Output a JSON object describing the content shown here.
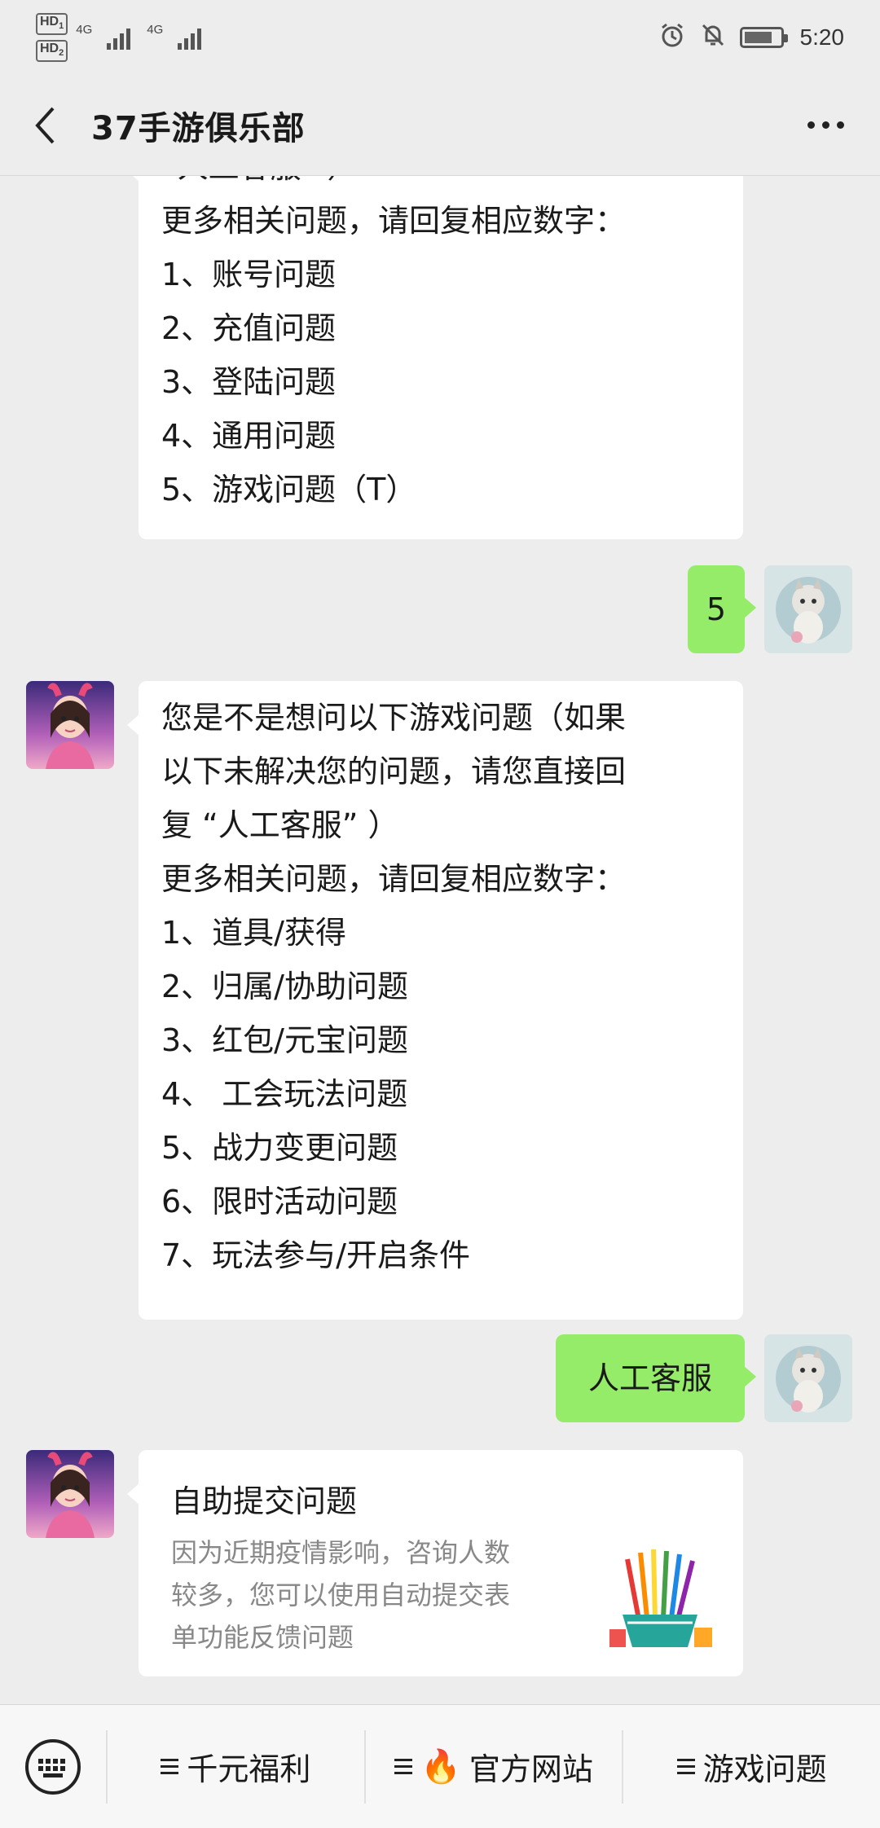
{
  "status_bar": {
    "hd1": "HD",
    "hd1_sub": "1",
    "hd2": "HD",
    "hd2_sub": "2",
    "net1": "4G",
    "net2": "4G",
    "time": "5:20",
    "icons": [
      "alarm-icon",
      "mute-icon",
      "battery-icon"
    ]
  },
  "header": {
    "title": "37手游俱乐部",
    "back_icon": "chevron-left-icon",
    "more_icon": "more-dots-icon"
  },
  "messages": [
    {
      "side": "in",
      "lines": [
        "“人工客服” ）",
        "更多相关问题，请回复相应数字：",
        "1、账号问题",
        "2、充值问题",
        "3、登陆问题",
        "4、通用问题",
        "5、游戏问题（T）"
      ]
    },
    {
      "side": "out",
      "text": "5"
    },
    {
      "side": "in",
      "lines": [
        "您是不是想问以下游戏问题（如果",
        "以下未解决您的问题，请您直接回",
        "复 “人工客服” ）",
        "更多相关问题，请回复相应数字：",
        "1、道具/获得",
        "2、归属/协助问题",
        "3、红包/元宝问题",
        "4、 工会玩法问题",
        "5、战力变更问题",
        "6、限时活动问题",
        "7、玩法参与/开启条件"
      ]
    },
    {
      "side": "out",
      "text": "人工客服"
    },
    {
      "side": "in",
      "card": {
        "title": "自助提交问题",
        "desc_lines": [
          "因为近期疫情影响，咨询人数",
          "较多，您可以使用自动提交表",
          "单功能反馈问题"
        ]
      }
    }
  ],
  "bottom_menu": {
    "keyboard_icon": "keyboard-icon",
    "items": [
      {
        "label": "千元福利",
        "icon": "menu-lines-icon"
      },
      {
        "label": "官方网站",
        "icon": "menu-lines-icon",
        "emoji": "🔥"
      },
      {
        "label": "游戏问题",
        "icon": "menu-lines-icon"
      }
    ]
  },
  "colors": {
    "background": "#ededed",
    "outgoing_bubble": "#95ec69",
    "incoming_bubble": "#ffffff"
  }
}
